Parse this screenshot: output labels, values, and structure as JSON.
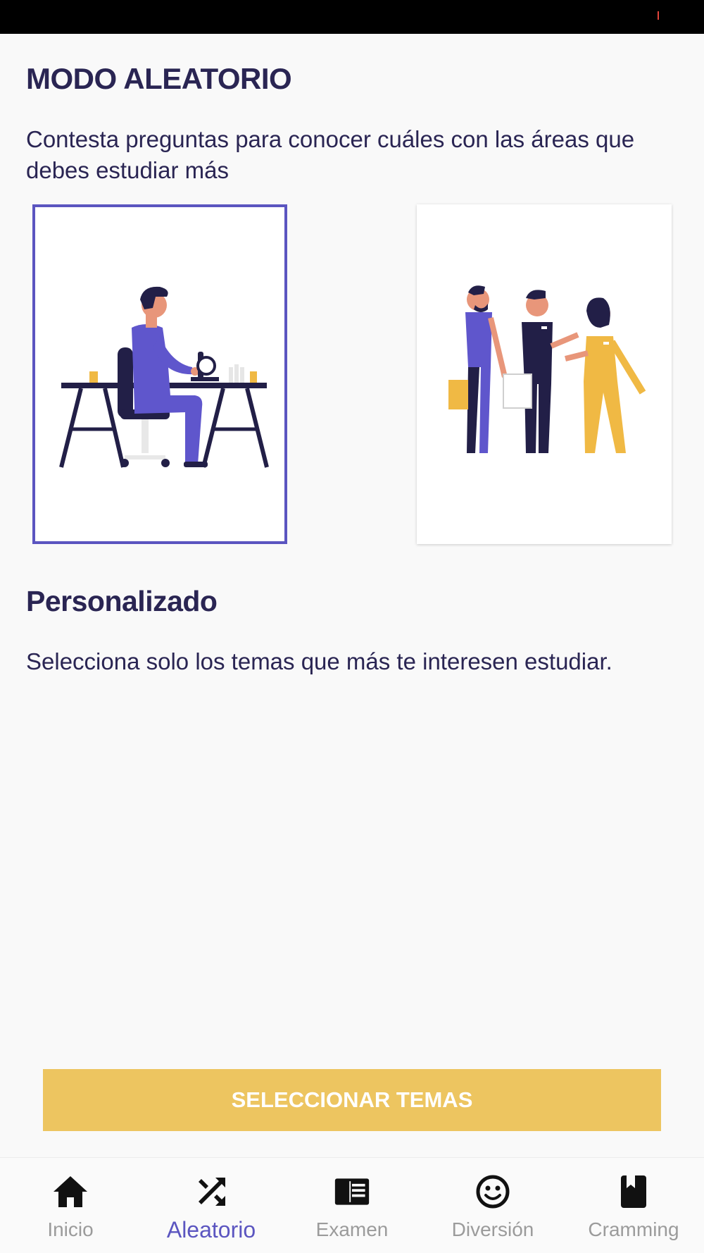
{
  "header": {
    "title": "MODO ALEATORIO",
    "subtitle": "Contesta preguntas para conocer cuáles con las áreas que debes estudiar más"
  },
  "cards": [
    {
      "id": "random",
      "selected": true,
      "icon": "scientist-at-desk-illustration"
    },
    {
      "id": "custom",
      "selected": false,
      "icon": "medical-team-illustration"
    }
  ],
  "section": {
    "title": "Personalizado",
    "description": "Selecciona solo los temas que más te interesen estudiar."
  },
  "cta": {
    "label": "SELECCIONAR TEMAS",
    "color": "#edc560"
  },
  "nav": {
    "active": "Aleatorio",
    "items": [
      {
        "label": "Inicio",
        "icon": "home-icon"
      },
      {
        "label": "Aleatorio",
        "icon": "shuffle-icon"
      },
      {
        "label": "Examen",
        "icon": "exam-icon"
      },
      {
        "label": "Diversión",
        "icon": "smiley-icon"
      },
      {
        "label": "Cramming",
        "icon": "book-icon"
      }
    ]
  },
  "colors": {
    "accent": "#5b55c0",
    "text": "#2a2553",
    "cta": "#edc560",
    "nav_inactive": "#9b9b9b"
  }
}
